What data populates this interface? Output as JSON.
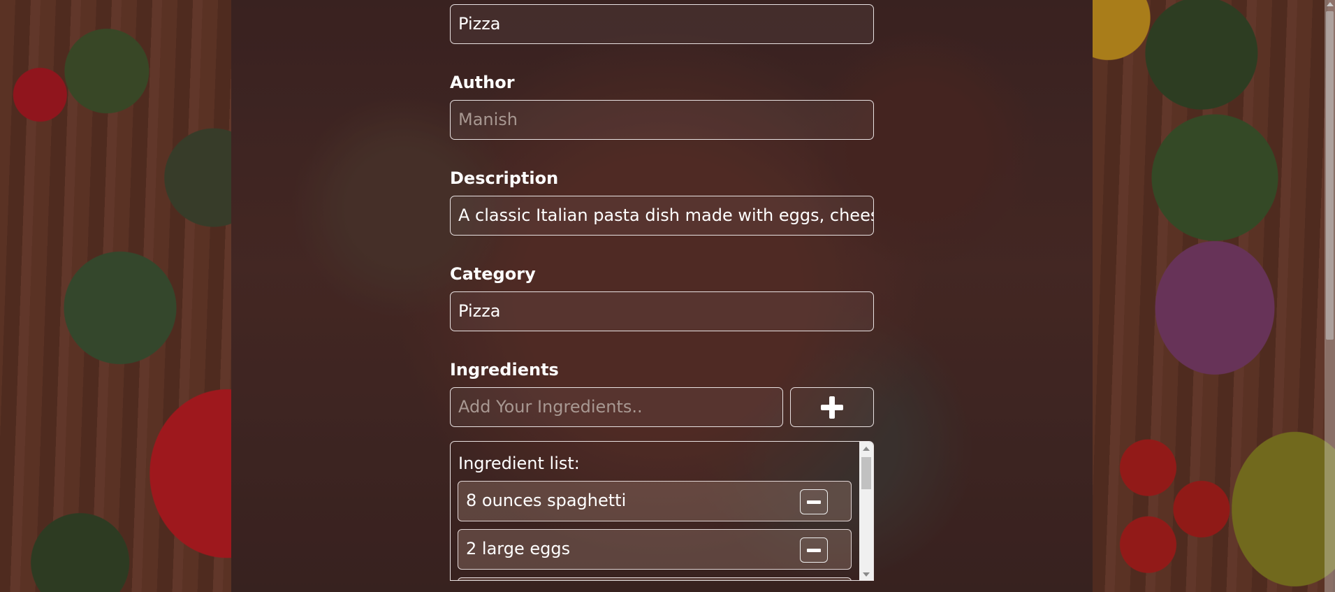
{
  "form": {
    "title_value": "Pizza",
    "author_label": "Author",
    "author_placeholder": "Manish",
    "description_label": "Description",
    "description_value": "A classic Italian pasta dish made with eggs, cheese, pancetta, and black pepper.",
    "category_label": "Category",
    "category_value": "Pizza",
    "ingredients_label": "Ingredients",
    "ingredients_placeholder": "Add Your Ingredients..",
    "add_icon": "plus-icon"
  },
  "ingredient_list": {
    "title": "Ingredient list:",
    "items": [
      {
        "label": "8 ounces spaghetti"
      },
      {
        "label": "2 large eggs"
      }
    ],
    "remove_icon": "minus-icon"
  }
}
